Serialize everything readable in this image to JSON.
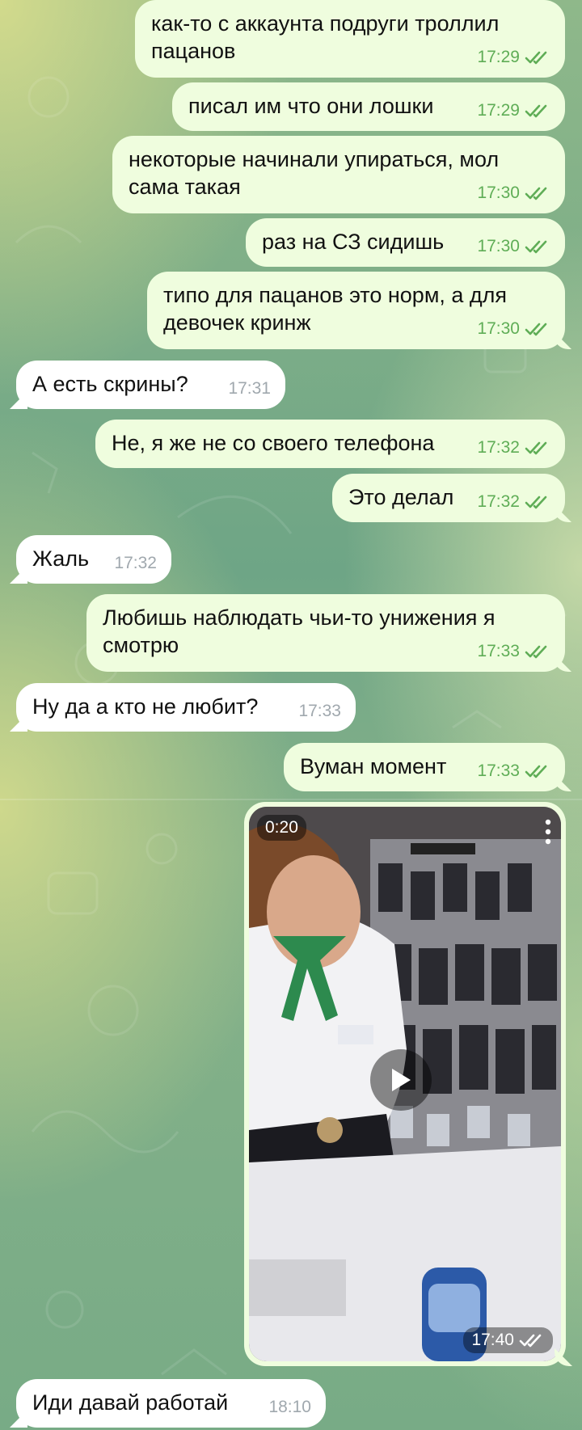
{
  "messages": [
    {
      "text": "как-то с аккаунта подруги троллил\nпацанов",
      "time": "17:29"
    },
    {
      "text": "писал им что они лошки",
      "time": "17:29"
    },
    {
      "text": "некоторые начинали упираться, мол\nсама такая",
      "time": "17:30"
    },
    {
      "text": "раз на СЗ сидишь",
      "time": "17:30"
    },
    {
      "text": "типо для пацанов это норм, а для\nдевочек кринж",
      "time": "17:30"
    },
    {
      "text": "А есть скрины?",
      "time": "17:31"
    },
    {
      "text": "Не, я же не со своего телефона",
      "time": "17:32"
    },
    {
      "text": "Это делал",
      "time": "17:32"
    },
    {
      "text": "Жаль",
      "time": "17:32"
    },
    {
      "text": "Любишь наблюдать чьи-то унижения я\nсмотрю",
      "time": "17:33"
    },
    {
      "text": "Ну да а кто не любит?",
      "time": "17:33"
    },
    {
      "text": "Вуман момент",
      "time": "17:33"
    },
    {
      "text": "Иди давай работай",
      "time": "18:10"
    }
  ],
  "video": {
    "duration": "0:20",
    "time": "17:40"
  },
  "colors": {
    "outgoing_bubble": "#effdde",
    "incoming_bubble": "#ffffff",
    "outgoing_time": "#5fad56",
    "incoming_time": "#a0a8ae"
  },
  "icons": {
    "read_status": "double-check-icon",
    "play": "play-icon",
    "menu": "more-vertical-icon"
  }
}
